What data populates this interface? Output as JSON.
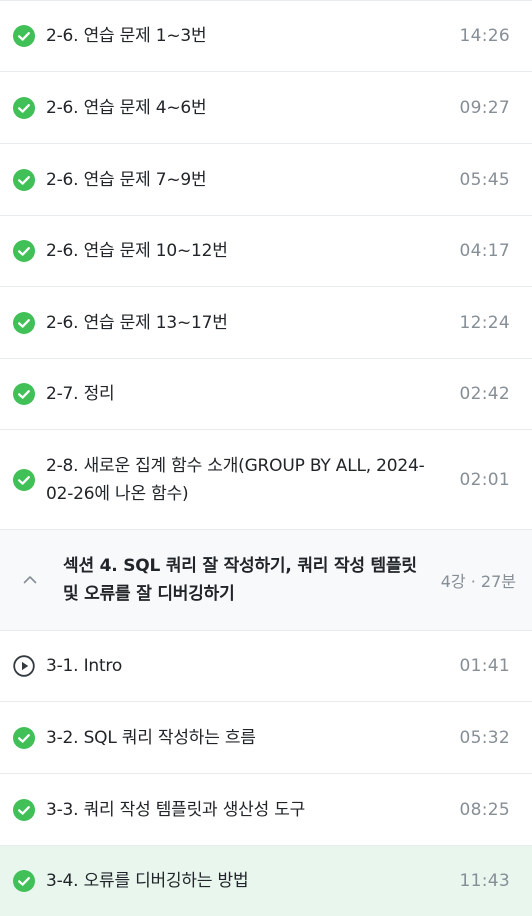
{
  "colors": {
    "check_green": "#40c057",
    "active_row_bg": "#e8f6ee",
    "section_bg": "#f8f9fa",
    "muted_text": "#868e96"
  },
  "lessons_top": [
    {
      "title": "2-6. 연습 문제 1~3번",
      "duration": "14:26",
      "status": "completed",
      "icon": "check-circle-icon"
    },
    {
      "title": "2-6. 연습 문제 4~6번",
      "duration": "09:27",
      "status": "completed",
      "icon": "check-circle-icon"
    },
    {
      "title": "2-6. 연습 문제 7~9번",
      "duration": "05:45",
      "status": "completed",
      "icon": "check-circle-icon"
    },
    {
      "title": "2-6. 연습 문제 10~12번",
      "duration": "04:17",
      "status": "completed",
      "icon": "check-circle-icon"
    },
    {
      "title": "2-6. 연습 문제 13~17번",
      "duration": "12:24",
      "status": "completed",
      "icon": "check-circle-icon"
    },
    {
      "title": "2-7. 정리",
      "duration": "02:42",
      "status": "completed",
      "icon": "check-circle-icon"
    },
    {
      "title": "2-8. 새로운 집계 함수 소개(GROUP BY ALL, 2024-02-26에 나온 함수)",
      "duration": "02:01",
      "status": "completed",
      "icon": "check-circle-icon"
    }
  ],
  "section": {
    "title": "섹션 4. SQL 쿼리 잘 작성하기, 쿼리 작성 템플릿 및 오류를 잘 디버깅하기",
    "meta": "4강 · 27분",
    "icon": "chevron-up-icon",
    "expanded": true
  },
  "lessons_bottom": [
    {
      "title": "3-1. Intro",
      "duration": "01:41",
      "status": "not-started",
      "icon": "play-circle-icon"
    },
    {
      "title": "3-2. SQL 쿼리 작성하는 흐름",
      "duration": "05:32",
      "status": "completed",
      "icon": "check-circle-icon"
    },
    {
      "title": "3-3. 쿼리 작성 템플릿과 생산성 도구",
      "duration": "08:25",
      "status": "completed",
      "icon": "check-circle-icon"
    },
    {
      "title": "3-4. 오류를 디버깅하는 방법",
      "duration": "11:43",
      "status": "completed",
      "icon": "check-circle-icon",
      "active": true
    }
  ]
}
